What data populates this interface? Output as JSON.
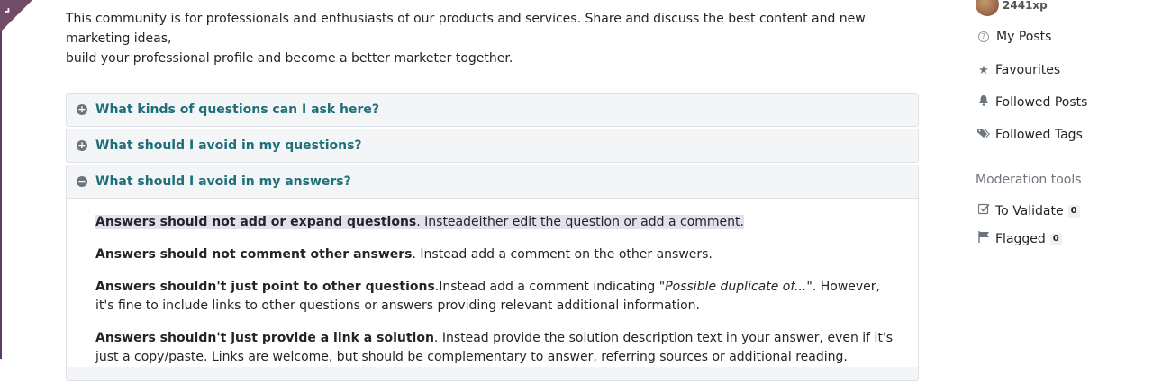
{
  "intro": {
    "line1": "This community is for professionals and enthusiasts of our products and services. Share and discuss the best content and new marketing ideas,",
    "line2": "build your professional profile and become a better marketer together."
  },
  "accordion": [
    {
      "title": "What kinds of questions can I ask here?",
      "icon": "plus-circle",
      "open": false
    },
    {
      "title": "What should I avoid in my questions?",
      "icon": "plus-circle",
      "open": false
    },
    {
      "title": "What should I avoid in my answers?",
      "icon": "minus-circle",
      "open": true
    }
  ],
  "answers": {
    "p1_bold": "Answers should not add or expand questions",
    "p1_rest": ". Insteadeither edit the question or add a comment.",
    "p2_bold": "Answers should not comment other answers",
    "p2_rest": ". Instead add a comment on the other answers.",
    "p3_bold": "Answers shouldn't just point to other questions",
    "p3_mid": ".Instead add a comment indicating ",
    "p3_italic": "\"Possible duplicate of...\"",
    "p3_rest": ". However, it's fine to include links to other questions or answers providing relevant additional information.",
    "p4_bold": "Answers shouldn't just provide a link a solution",
    "p4_rest": ". Instead provide the solution description text in your answer, even if it's just a copy/paste. Links are welcome, but should be complementary to answer, referring sources or additional reading."
  },
  "sidebar": {
    "xp": "2441xp",
    "links": [
      {
        "label": "My Posts",
        "icon": "question-circle-icon",
        "glyph": "?"
      },
      {
        "label": "Favourites",
        "icon": "star-icon",
        "glyph": "★"
      },
      {
        "label": "Followed Posts",
        "icon": "bell-icon",
        "glyph": "🔔"
      },
      {
        "label": "Followed Tags",
        "icon": "tags-icon",
        "glyph": "🏷"
      }
    ],
    "moderation_title": "Moderation tools",
    "to_validate_label": "To Validate",
    "to_validate_count": "0",
    "flagged_label": "Flagged",
    "flagged_count": "0"
  }
}
